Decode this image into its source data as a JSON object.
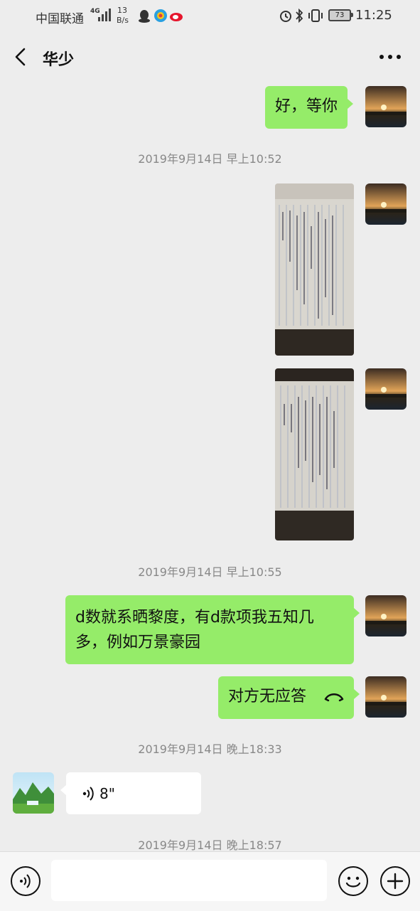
{
  "status_bar": {
    "carrier": "中国联通",
    "network": "4G",
    "speed_value": "13",
    "speed_unit": "B/s",
    "battery": "73",
    "time": "11:25"
  },
  "header": {
    "title": "华少"
  },
  "messages": [
    {
      "type": "text_out",
      "text": "好，等你"
    },
    {
      "type": "timestamp",
      "text": "2019年9月14日 早上10:52"
    },
    {
      "type": "timestamp",
      "text": "2019年9月14日 早上10:55"
    },
    {
      "type": "text_out",
      "text": "d数就系晒黎度，有d款项我五知几多，例如万景豪园"
    },
    {
      "type": "call_out",
      "text": "对方无应答"
    },
    {
      "type": "timestamp",
      "text": "2019年9月14日 晚上18:33"
    },
    {
      "type": "voice_in",
      "duration": "8\""
    },
    {
      "type": "timestamp",
      "text": "2019年9月14日 晚上18:57"
    }
  ],
  "colors": {
    "background": "#ededed",
    "bubble_out": "#95ec69",
    "bubble_in": "#ffffff",
    "timestamp": "#888888"
  },
  "icons": [
    "back-arrow-icon",
    "more-icon",
    "voice-icon",
    "emoji-icon",
    "plus-icon",
    "hangup-icon",
    "voice-wave-icon"
  ]
}
